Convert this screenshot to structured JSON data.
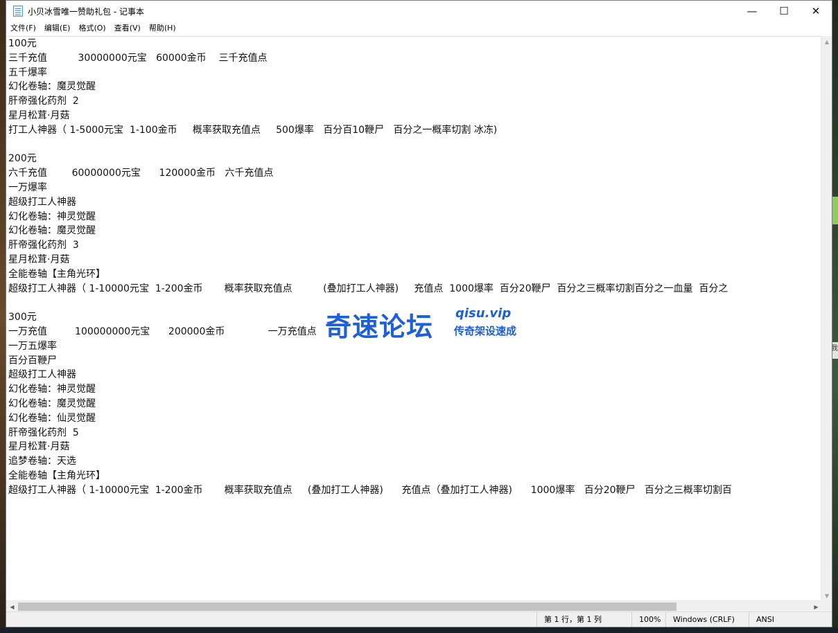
{
  "window": {
    "title": "小贝冰雪唯一赞助礼包 - 记事本",
    "controls": {
      "minimize": "—",
      "maximize": "☐",
      "close": "✕"
    }
  },
  "menu": {
    "items": [
      "文件(F)",
      "编辑(E)",
      "格式(O)",
      "查看(V)",
      "帮助(H)"
    ]
  },
  "document": {
    "lines": [
      "100元",
      "三千充值          30000000元宝   60000金币    三千充值点",
      "五千爆率",
      "幻化卷轴：魔灵觉醒",
      "肝帝强化药剂  2",
      "星月松茸·月菇",
      "打工人神器（ 1-5000元宝  1-100金币     概率获取充值点     500爆率   百分百10鞭尸   百分之一概率切割 冰冻)",
      "",
      "200元",
      "六千充值        60000000元宝      120000金币   六千充值点",
      "一万爆率",
      "超级打工人神器",
      "幻化卷轴：神灵觉醒",
      "幻化卷轴：魔灵觉醒",
      "肝帝强化药剂  3",
      "星月松茸·月菇",
      "全能卷轴【主角光环】",
      "超级打工人神器（ 1-10000元宝  1-200金币       概率获取充值点          (叠加打工人神器)     充值点  1000爆率  百分20鞭尸  百分之三概率切割百分之一血量  百分之",
      "",
      "300元",
      "一万充值         100000000元宝      200000金币              一万充值点",
      "一万五爆率",
      "百分百鞭尸",
      "超级打工人神器",
      "幻化卷轴：神灵觉醒",
      "幻化卷轴：魔灵觉醒",
      "幻化卷轴：仙灵觉醒",
      "肝帝强化药剂  5",
      "星月松茸·月菇",
      "追梦卷轴：天选",
      "全能卷轴【主角光环】",
      "超级打工人神器（ 1-10000元宝  1-200金币       概率获取充值点     (叠加打工人神器)      充值点（叠加打工人神器)      1000爆率   百分20鞭尸   百分之三概率切割百"
    ]
  },
  "watermark": {
    "main": "奇速论坛",
    "domain": "qisu.vip",
    "slogan": "传奇架设速成"
  },
  "status": {
    "position": "第 1 行，第 1 列",
    "zoom": "100%",
    "line_ending": "Windows (CRLF)",
    "encoding": "ANSI"
  },
  "background": {
    "right_edge_text": "我"
  }
}
